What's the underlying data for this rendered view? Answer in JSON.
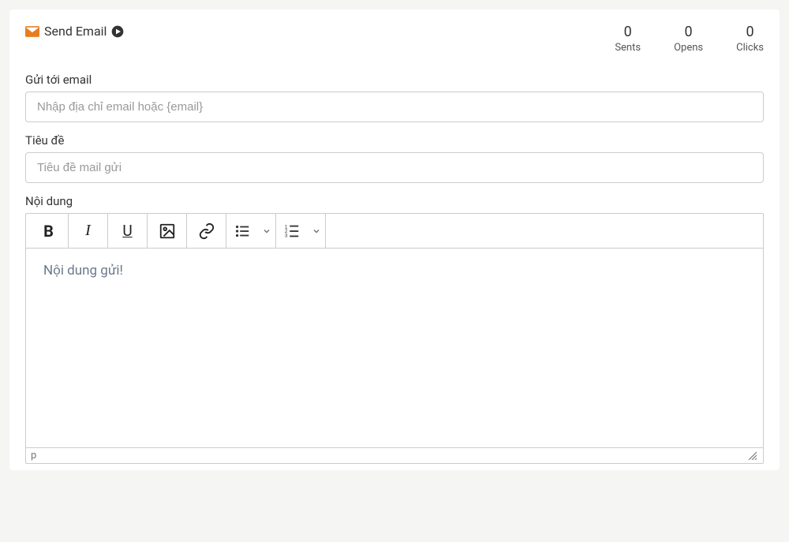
{
  "header": {
    "title": "Send Email"
  },
  "stats": {
    "sents": {
      "value": "0",
      "label": "Sents"
    },
    "opens": {
      "value": "0",
      "label": "Opens"
    },
    "clicks": {
      "value": "0",
      "label": "Clicks"
    }
  },
  "fields": {
    "to": {
      "label": "Gửi tới email",
      "placeholder": "Nhập địa chỉ email hoặc {email}",
      "value": ""
    },
    "subject": {
      "label": "Tiêu đề",
      "placeholder": "Tiêu đề mail gửi",
      "value": ""
    },
    "body": {
      "label": "Nội dung",
      "placeholder": "Nội dung gửi!"
    }
  },
  "editor": {
    "status_path": "p"
  },
  "toolbar": {
    "bold": "B",
    "italic": "I",
    "underline": "U"
  }
}
